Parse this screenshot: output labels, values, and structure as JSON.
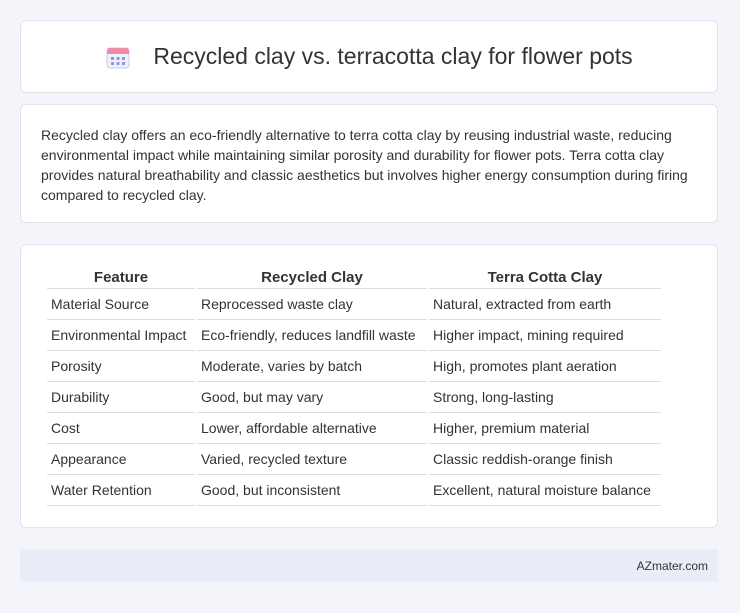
{
  "header": {
    "title": "Recycled clay vs. terracotta clay for flower pots",
    "icon": "calendar-icon"
  },
  "intro": "Recycled clay offers an eco-friendly alternative to terra cotta clay by reusing industrial waste, reducing environmental impact while maintaining similar porosity and durability for flower pots. Terra cotta clay provides natural breathability and classic aesthetics but involves higher energy consumption during firing compared to recycled clay.",
  "table": {
    "headers": [
      "Feature",
      "Recycled Clay",
      "Terra Cotta Clay"
    ],
    "rows": [
      [
        "Material Source",
        "Reprocessed waste clay",
        "Natural, extracted from earth"
      ],
      [
        "Environmental Impact",
        "Eco-friendly, reduces landfill waste",
        "Higher impact, mining required"
      ],
      [
        "Porosity",
        "Moderate, varies by batch",
        "High, promotes plant aeration"
      ],
      [
        "Durability",
        "Good, but may vary",
        "Strong, long-lasting"
      ],
      [
        "Cost",
        "Lower, affordable alternative",
        "Higher, premium material"
      ],
      [
        "Appearance",
        "Varied, recycled texture",
        "Classic reddish-orange finish"
      ],
      [
        "Water Retention",
        "Good, but inconsistent",
        "Excellent, natural moisture balance"
      ]
    ]
  },
  "footer": {
    "source": "AZmater.com"
  }
}
